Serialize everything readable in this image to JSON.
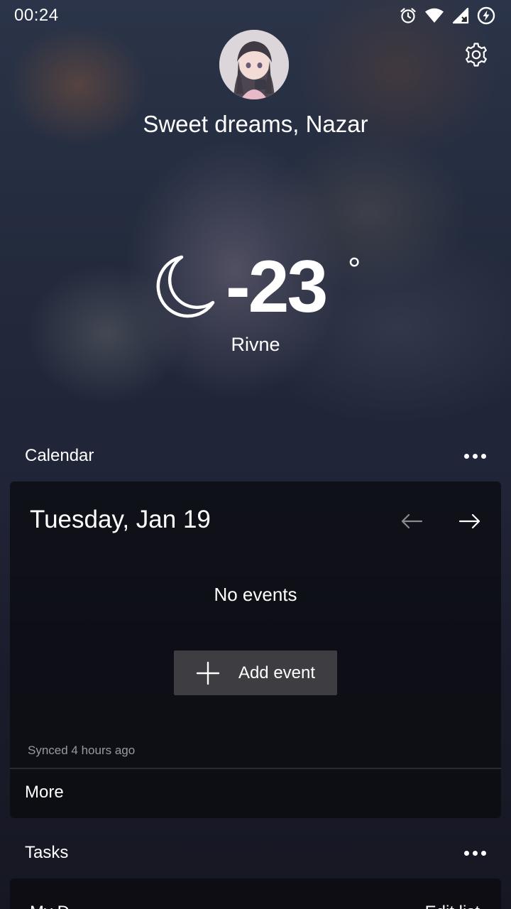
{
  "status_bar": {
    "time": "00:24",
    "icons": [
      "alarm-icon",
      "wifi-icon",
      "cell-signal-icon",
      "battery-charging-icon"
    ]
  },
  "header": {
    "greeting": "Sweet dreams, Nazar",
    "settings_icon": "gear-icon"
  },
  "weather": {
    "icon": "moon-icon",
    "temperature": "-23",
    "unit": "°",
    "location": "Rivne"
  },
  "calendar": {
    "section_title": "Calendar",
    "date": "Tuesday, Jan 19",
    "empty_text": "No events",
    "add_label": "Add event",
    "synced_text": "Synced 4 hours ago",
    "more_label": "More"
  },
  "tasks": {
    "section_title": "Tasks",
    "list_title": "My D",
    "edit_label": "Edit list"
  },
  "colors": {
    "card_bg": "#0a0a0e",
    "button_bg": "#3e3e42",
    "muted_text": "#9a9aa0"
  }
}
